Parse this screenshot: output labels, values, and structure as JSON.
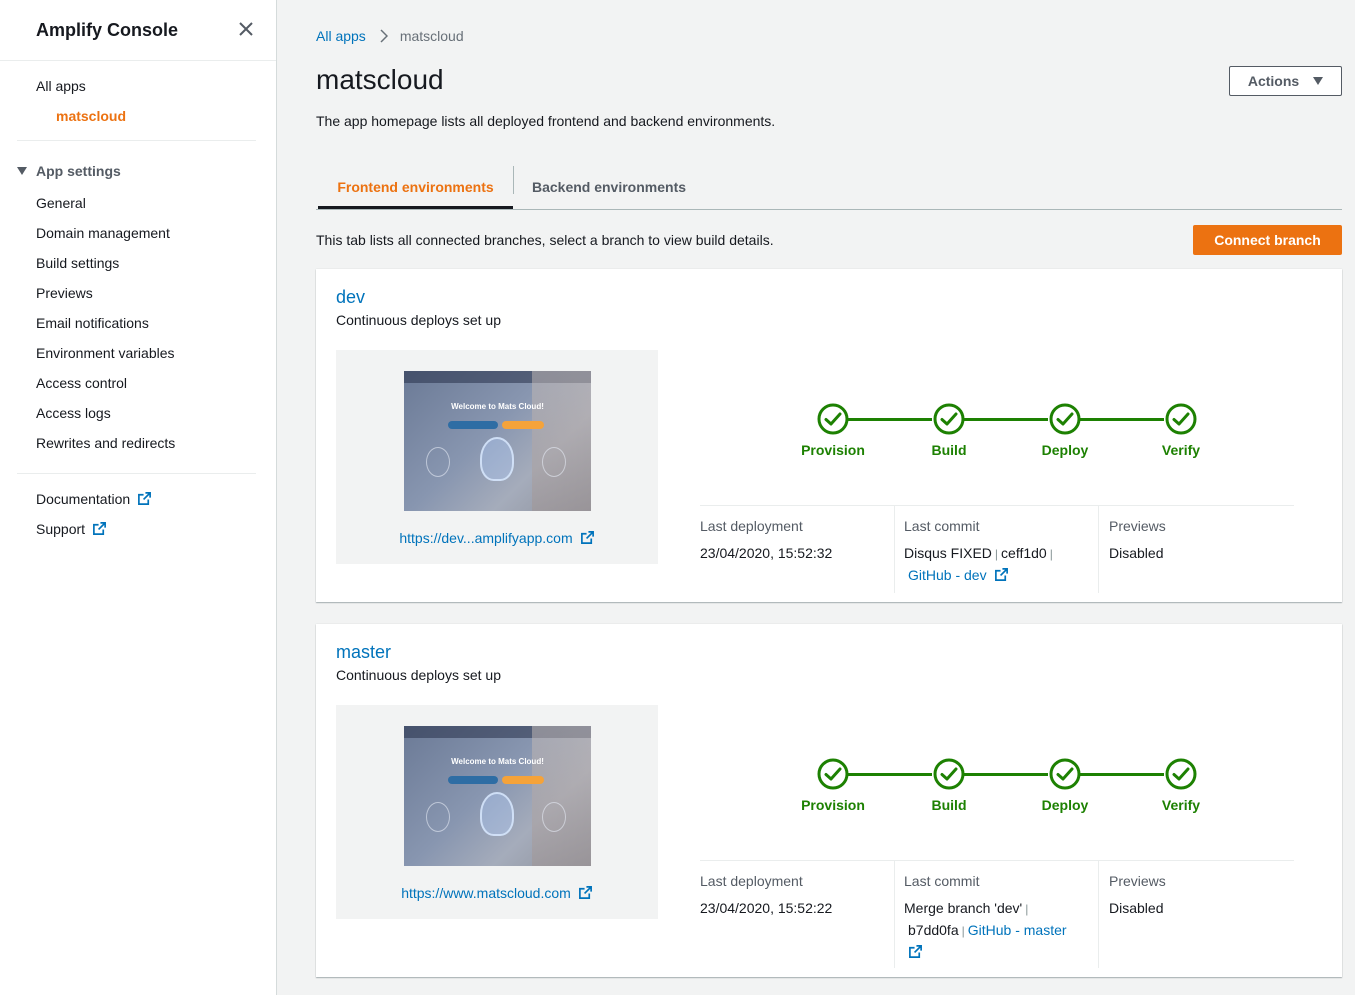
{
  "sidebar": {
    "title": "Amplify Console",
    "all_apps": "All apps",
    "current_app": "matscloud",
    "section": "App settings",
    "items": [
      "General",
      "Domain management",
      "Build settings",
      "Previews",
      "Email notifications",
      "Environment variables",
      "Access control",
      "Access logs",
      "Rewrites and redirects"
    ],
    "documentation": "Documentation",
    "support": "Support"
  },
  "breadcrumb": {
    "root": "All apps",
    "current": "matscloud"
  },
  "page": {
    "title": "matscloud",
    "actions_label": "Actions",
    "description": "The app homepage lists all deployed frontend and backend environments."
  },
  "tabs": {
    "frontend": "Frontend environments",
    "backend": "Backend environments",
    "info": "This tab lists all connected branches, select a branch to view build details.",
    "connect_label": "Connect branch"
  },
  "branches": [
    {
      "name": "dev",
      "status": "Continuous deploys set up",
      "thumb_title": "Welcome to Mats Cloud!",
      "url": "https://dev...amplifyapp.com",
      "stages": [
        "Provision",
        "Build",
        "Deploy",
        "Verify"
      ],
      "last_deployment_label": "Last deployment",
      "last_deployment": "23/04/2020, 15:52:32",
      "last_commit_label": "Last commit",
      "commit_message": "Disqus FIXED",
      "commit_hash": "ceff1d0",
      "commit_link": "GitHub - dev",
      "previews_label": "Previews",
      "previews": "Disabled"
    },
    {
      "name": "master",
      "status": "Continuous deploys set up",
      "thumb_title": "Welcome to Mats Cloud!",
      "url": "https://www.matscloud.com",
      "stages": [
        "Provision",
        "Build",
        "Deploy",
        "Verify"
      ],
      "last_deployment_label": "Last deployment",
      "last_deployment": "23/04/2020, 15:52:22",
      "last_commit_label": "Last commit",
      "commit_message": "Merge branch 'dev'",
      "commit_hash": "b7dd0fa",
      "commit_link": "GitHub - master",
      "previews_label": "Previews",
      "previews": "Disabled"
    }
  ],
  "colors": {
    "accent": "#ec7211",
    "link": "#0073bb",
    "success": "#1d8102"
  }
}
